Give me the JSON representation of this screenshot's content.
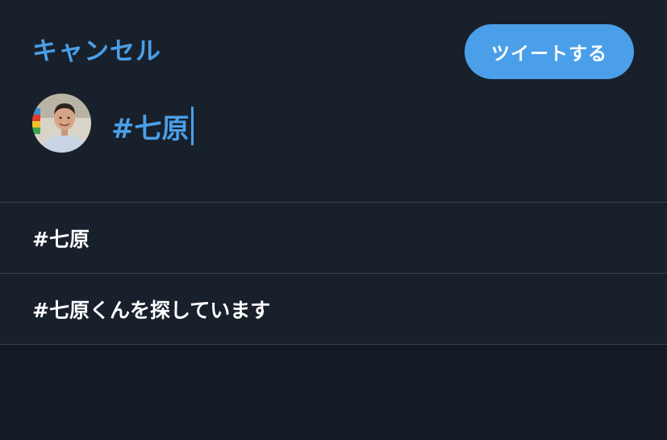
{
  "header": {
    "cancel_label": "キャンセル",
    "tweet_label": "ツイートする"
  },
  "composer": {
    "text": "#七原",
    "avatar_icon": "user-avatar"
  },
  "suggestions": [
    {
      "label": "#七原"
    },
    {
      "label": "#七原くんを探しています"
    }
  ],
  "colors": {
    "background": "#141a23",
    "panel": "#18202b",
    "accent": "#4a9fe8",
    "divider": "#38414d",
    "text": "#ffffff"
  }
}
